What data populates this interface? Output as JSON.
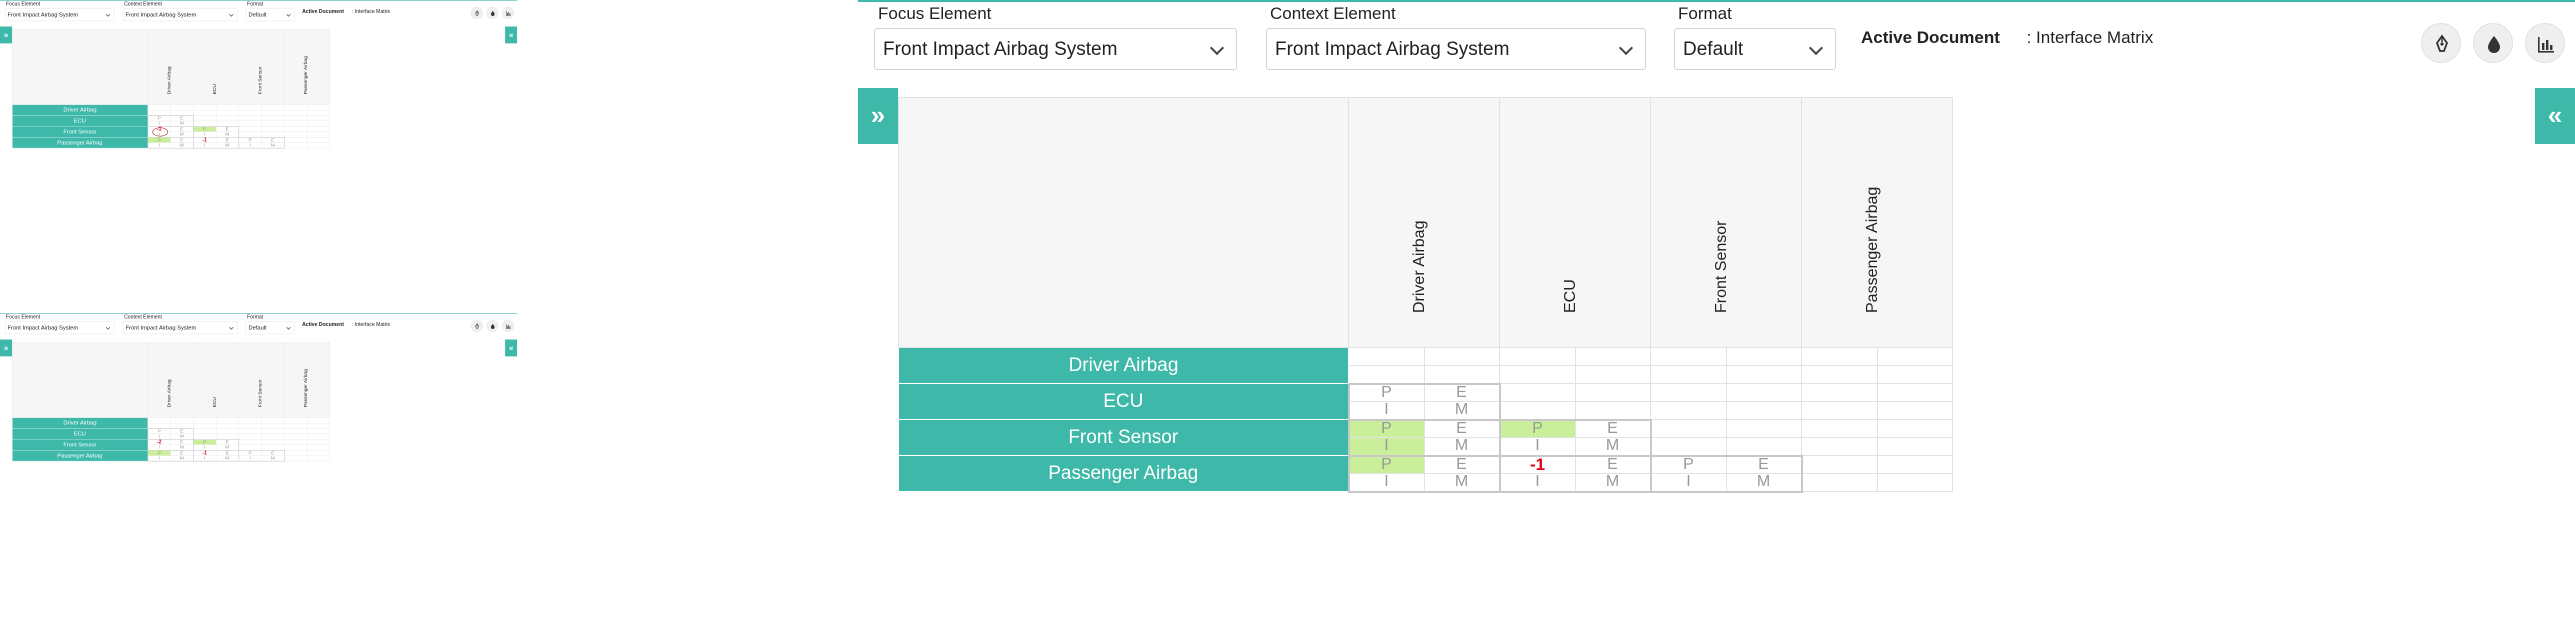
{
  "toolbar": {
    "focus_label": "Focus Element",
    "focus_value": "Front Impact Airbag System",
    "context_label": "Context Element",
    "context_value": "Front Impact Airbag System",
    "format_label": "Format",
    "format_value": "Default",
    "active_label": "Active Document",
    "active_value": ": Interface Matrix"
  },
  "toggles": {
    "left": "»",
    "right": "«"
  },
  "columns": [
    "Driver Airbag",
    "ECU",
    "Front Sensor",
    "Passenger Airbag"
  ],
  "rows": [
    "Driver Airbag",
    "ECU",
    "Front Sensor",
    "Passenger Airbag"
  ],
  "cell_letters": {
    "p": "P",
    "e": "E",
    "i": "I",
    "m": "M"
  },
  "panels": {
    "top_left": {
      "front_sensor_driver": "-1",
      "passenger_ecu": "-1"
    },
    "bottom_left": {
      "front_sensor_driver": "-2",
      "passenger_ecu": "-1"
    },
    "main": {
      "passenger_ecu": "-1"
    }
  },
  "colors": {
    "accent": "#3db8a9",
    "highlight": "#c9ef9a",
    "negative": "#e0001b"
  },
  "icons": [
    "pen-tool-icon",
    "droplet-icon",
    "bar-chart-icon"
  ]
}
